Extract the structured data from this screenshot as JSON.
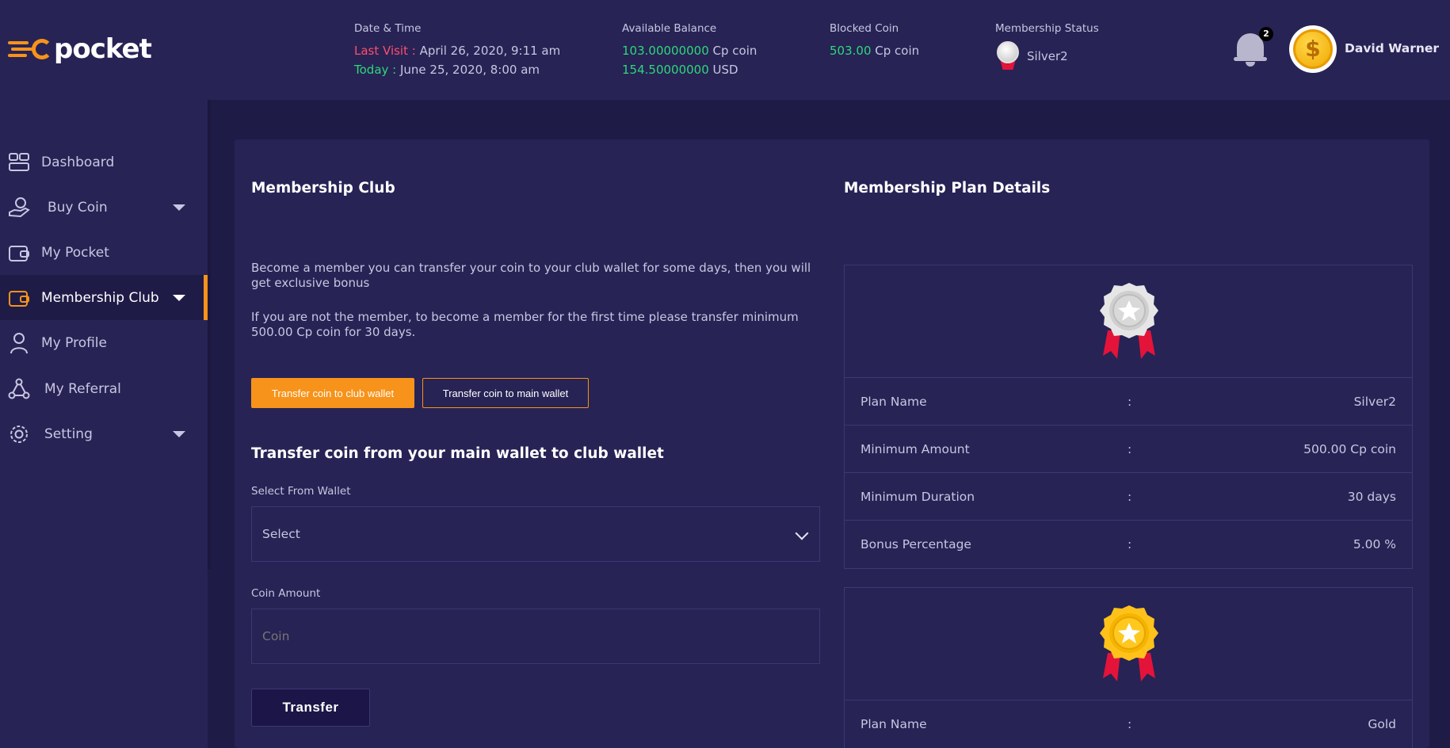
{
  "app": {
    "logo_text": "pocket",
    "brand_color": "#f7931a"
  },
  "header": {
    "datetime": {
      "label": "Date & Time",
      "last_visit_label": "Last Visit :",
      "last_visit_value": "April 26, 2020, 9:11 am",
      "today_label": "Today :",
      "today_value": "June 25, 2020, 8:00 am"
    },
    "balance": {
      "label": "Available Balance",
      "cp_amount": "103.00000000",
      "cp_unit": "Cp coin",
      "usd_amount": "154.50000000",
      "usd_unit": "USD"
    },
    "blocked": {
      "label": "Blocked Coin",
      "amount": "503.00",
      "unit": "Cp coin"
    },
    "membership": {
      "label": "Membership Status",
      "value": "Silver2"
    },
    "notifications": {
      "count": "2",
      "icon": "bell-icon"
    },
    "user": {
      "name": "David Warner",
      "avatar_symbol": "$"
    }
  },
  "sidebar": {
    "items": [
      {
        "label": "Dashboard",
        "icon": "dashboard-icon"
      },
      {
        "label": "Buy Coin",
        "icon": "buy-coin-icon",
        "has_caret": true
      },
      {
        "label": "My Pocket",
        "icon": "wallet-icon"
      },
      {
        "label": "Membership Club",
        "icon": "wallet-icon",
        "has_caret": true,
        "active": true
      },
      {
        "label": "My Profile",
        "icon": "user-icon"
      },
      {
        "label": "My Referral",
        "icon": "referral-icon"
      },
      {
        "label": "Setting",
        "icon": "gear-icon",
        "has_caret": true
      }
    ]
  },
  "main": {
    "club": {
      "title": "Membership Club",
      "para1": "Become a member you can transfer your coin to your club wallet for some days, then you will get exclusive bonus",
      "para2": "If you are not the member, to become a member for the first time please transfer minimum 500.00 Cp coin for 30 days.",
      "btn_to_club": "Transfer coin to club wallet",
      "btn_to_main": "Transfer coin to main wallet"
    },
    "form": {
      "title": "Transfer coin from your main wallet to club wallet",
      "wallet_label": "Select From Wallet",
      "wallet_selected": "Select",
      "amount_label": "Coin Amount",
      "amount_placeholder": "Coin",
      "submit_label": "Transfer"
    },
    "plans": {
      "title": "Membership Plan Details",
      "separator": ":",
      "silver": {
        "medal": "silver-medal-icon",
        "rows": [
          {
            "key": "Plan Name",
            "value": "Silver2"
          },
          {
            "key": "Minimum Amount",
            "value": "500.00 Cp coin"
          },
          {
            "key": "Minimum Duration",
            "value": "30 days"
          },
          {
            "key": "Bonus Percentage",
            "value": "5.00 %"
          }
        ]
      },
      "gold": {
        "medal": "gold-medal-icon",
        "rows": [
          {
            "key": "Plan Name",
            "value": "Gold"
          }
        ]
      }
    }
  },
  "colors": {
    "background": "#1f1b47",
    "panel": "#272355",
    "accent": "#f7931a",
    "red": "#ff4d6d",
    "green": "#2fd77a"
  }
}
